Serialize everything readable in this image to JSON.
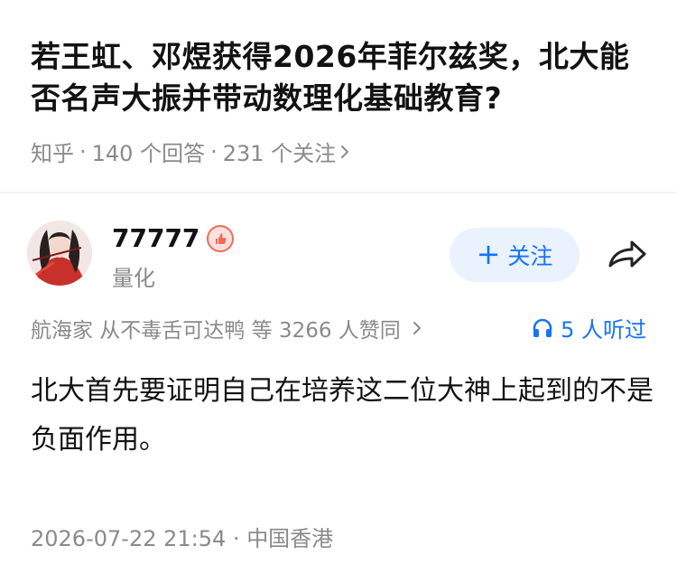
{
  "question": {
    "title": "若王虹、邓煜获得2026年菲尔兹奖，北大能否名声大振并带动数理化基础教育?",
    "source": "知乎",
    "answers_count": "140 个回答",
    "followers_count": "231 个关注"
  },
  "author": {
    "name": "77777",
    "tag": "量化",
    "follow_label": "关注"
  },
  "votes": {
    "text": "航海家 从不毒舌可达鸭 等 3266 人赞同"
  },
  "listen": {
    "text": "5 人听过"
  },
  "answer": {
    "content": "北大首先要证明自己在培养这二位大神上起到的不是负面作用。"
  },
  "footer": {
    "timestamp": "2026-07-22 21:54",
    "location": "中国香港"
  },
  "colors": {
    "accent": "#1772f6",
    "muted": "#8a8a8a"
  },
  "icons": [
    "chevron-right-icon",
    "plus-icon",
    "share-icon",
    "headphones-icon",
    "verified-badge-icon"
  ]
}
